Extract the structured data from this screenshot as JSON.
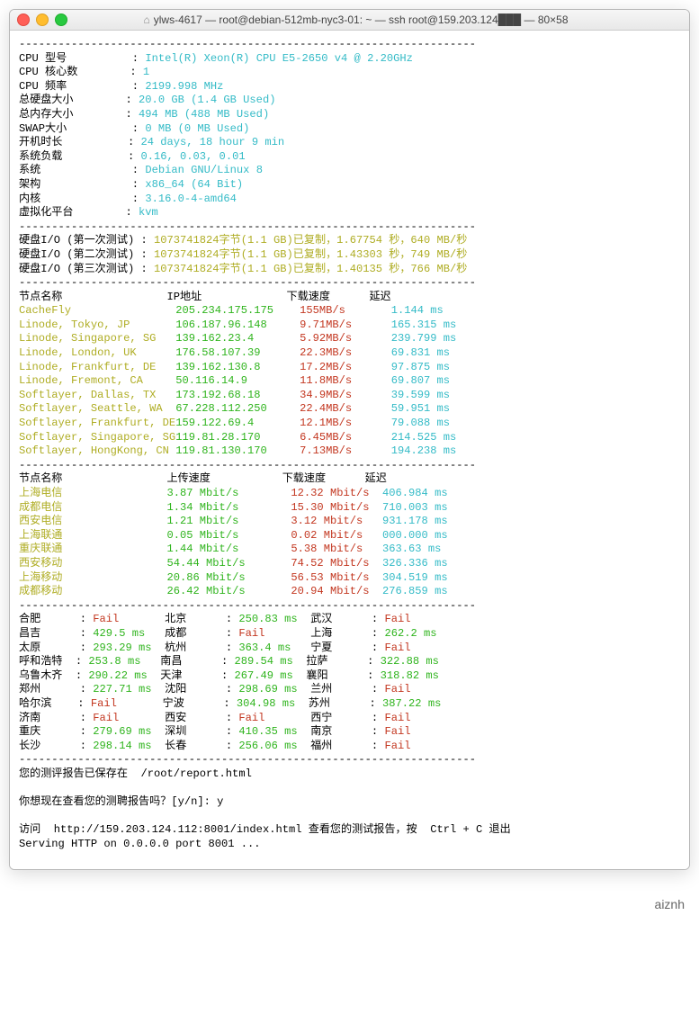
{
  "window": {
    "title": "ylws-4617 — root@debian-512mb-nyc3-01: ~ — ssh root@159.203.124███ — 80×58"
  },
  "dashes": "----------------------------------------------------------------------",
  "sysinfo": [
    {
      "label": "CPU 型号",
      "value": "Intel(R) Xeon(R) CPU E5-2650 v4 @ 2.20GHz"
    },
    {
      "label": "CPU 核心数",
      "value": "1"
    },
    {
      "label": "CPU 频率",
      "value": "2199.998 MHz"
    },
    {
      "label": "总硬盘大小",
      "value": "20.0 GB (1.4 GB Used)"
    },
    {
      "label": "总内存大小",
      "value": "494 MB (488 MB Used)"
    },
    {
      "label": "SWAP大小",
      "value": "0 MB (0 MB Used)"
    },
    {
      "label": "开机时长",
      "value": "24 days, 18 hour 9 min"
    },
    {
      "label": "系统负载",
      "value": "0.16, 0.03, 0.01"
    },
    {
      "label": "系统",
      "value": "Debian GNU/Linux 8"
    },
    {
      "label": "架构",
      "value": "x86_64 (64 Bit)"
    },
    {
      "label": "内核",
      "value": "3.16.0-4-amd64"
    },
    {
      "label": "虚拟化平台",
      "value": "kvm"
    }
  ],
  "iotests": [
    {
      "label": "硬盘I/O (第一次测试)",
      "value": "1073741824字节(1.1 GB)已复制，1.67754 秒，640 MB/秒"
    },
    {
      "label": "硬盘I/O (第二次测试)",
      "value": "1073741824字节(1.1 GB)已复制，1.43303 秒，749 MB/秒"
    },
    {
      "label": "硬盘I/O (第三次测试)",
      "value": "1073741824字节(1.1 GB)已复制，1.40135 秒，766 MB/秒"
    }
  ],
  "dlheader": {
    "name": "节点名称",
    "ip": "IP地址",
    "speed": "下载速度",
    "lat": "延迟"
  },
  "dlnodes": [
    {
      "name": "CacheFly",
      "ip": "205.234.175.175",
      "speed": "155MB/s",
      "lat": "1.144 ms"
    },
    {
      "name": "Linode, Tokyo, JP",
      "ip": "106.187.96.148",
      "speed": "9.71MB/s",
      "lat": "165.315 ms"
    },
    {
      "name": "Linode, Singapore, SG",
      "ip": "139.162.23.4",
      "speed": "5.92MB/s",
      "lat": "239.799 ms"
    },
    {
      "name": "Linode, London, UK",
      "ip": "176.58.107.39",
      "speed": "22.3MB/s",
      "lat": "69.831 ms"
    },
    {
      "name": "Linode, Frankfurt, DE",
      "ip": "139.162.130.8",
      "speed": "17.2MB/s",
      "lat": "97.875 ms"
    },
    {
      "name": "Linode, Fremont, CA",
      "ip": "50.116.14.9",
      "speed": "11.8MB/s",
      "lat": "69.807 ms"
    },
    {
      "name": "Softlayer, Dallas, TX",
      "ip": "173.192.68.18",
      "speed": "34.9MB/s",
      "lat": "39.599 ms"
    },
    {
      "name": "Softlayer, Seattle, WA",
      "ip": "67.228.112.250",
      "speed": "22.4MB/s",
      "lat": "59.951 ms"
    },
    {
      "name": "Softlayer, Frankfurt, DE",
      "ip": "159.122.69.4",
      "speed": "12.1MB/s",
      "lat": "79.088 ms"
    },
    {
      "name": "Softlayer, Singapore, SG",
      "ip": "119.81.28.170",
      "speed": "6.45MB/s",
      "lat": "214.525 ms"
    },
    {
      "name": "Softlayer, HongKong, CN",
      "ip": "119.81.130.170",
      "speed": "7.13MB/s",
      "lat": "194.238 ms"
    }
  ],
  "cnheader": {
    "name": "节点名称",
    "up": "上传速度",
    "down": "下载速度",
    "lat": "延迟"
  },
  "cnnodes": [
    {
      "name": "上海电信",
      "up": "3.87 Mbit/s",
      "down": "12.32 Mbit/s",
      "lat": "406.984 ms"
    },
    {
      "name": "成都电信",
      "up": "1.34 Mbit/s",
      "down": "15.30 Mbit/s",
      "lat": "710.003 ms"
    },
    {
      "name": "西安电信",
      "up": "1.21 Mbit/s",
      "down": "3.12 Mbit/s",
      "lat": "931.178 ms"
    },
    {
      "name": "上海联通",
      "up": "0.05 Mbit/s",
      "down": "0.02 Mbit/s",
      "lat": "000.000 ms"
    },
    {
      "name": "重庆联通",
      "up": "1.44 Mbit/s",
      "down": "5.38 Mbit/s",
      "lat": "363.63 ms"
    },
    {
      "name": "西安移动",
      "up": "54.44 Mbit/s",
      "down": "74.52 Mbit/s",
      "lat": "326.336 ms"
    },
    {
      "name": "上海移动",
      "up": "20.86 Mbit/s",
      "down": "56.53 Mbit/s",
      "lat": "304.519 ms"
    },
    {
      "name": "成都移动",
      "up": "26.42 Mbit/s",
      "down": "20.94 Mbit/s",
      "lat": "276.859 ms"
    }
  ],
  "pingrows": [
    {
      "c1": "合肥",
      "v1": "Fail",
      "c2": "北京",
      "v2": "250.83 ms",
      "c3": "武汉",
      "v3": "Fail"
    },
    {
      "c1": "昌吉",
      "v1": "429.5 ms",
      "c2": "成都",
      "v2": "Fail",
      "c3": "上海",
      "v3": "262.2 ms"
    },
    {
      "c1": "太原",
      "v1": "293.29 ms",
      "c2": "杭州",
      "v2": "363.4 ms",
      "c3": "宁夏",
      "v3": "Fail"
    },
    {
      "c1": "呼和浩特",
      "v1": "253.8 ms",
      "c2": "南昌",
      "v2": "289.54 ms",
      "c3": "拉萨",
      "v3": "322.88 ms"
    },
    {
      "c1": "乌鲁木齐",
      "v1": "290.22 ms",
      "c2": "天津",
      "v2": "267.49 ms",
      "c3": "襄阳",
      "v3": "318.82 ms"
    },
    {
      "c1": "郑州",
      "v1": "227.71 ms",
      "c2": "沈阳",
      "v2": "298.69 ms",
      "c3": "兰州",
      "v3": "Fail"
    },
    {
      "c1": "哈尔滨",
      "v1": "Fail",
      "c2": "宁波",
      "v2": "304.98 ms",
      "c3": "苏州",
      "v3": "387.22 ms"
    },
    {
      "c1": "济南",
      "v1": "Fail",
      "c2": "西安",
      "v2": "Fail",
      "c3": "西宁",
      "v3": "Fail"
    },
    {
      "c1": "重庆",
      "v1": "279.69 ms",
      "c2": "深圳",
      "v2": "410.35 ms",
      "c3": "南京",
      "v3": "Fail"
    },
    {
      "c1": "长沙",
      "v1": "298.14 ms",
      "c2": "长春",
      "v2": "256.06 ms",
      "c3": "福州",
      "v3": "Fail"
    }
  ],
  "footer": {
    "saved": "您的测评报告已保存在  /root/report.html",
    "prompt": "你想现在查看您的测聘报告吗？[y/n]: y",
    "visit": "访问  http://159.203.124.112:8001/index.html 查看您的测试报告，按  Ctrl + C 退出",
    "serving": "Serving HTTP on 0.0.0.0 port 8001 ..."
  },
  "watermark": "aiznh"
}
